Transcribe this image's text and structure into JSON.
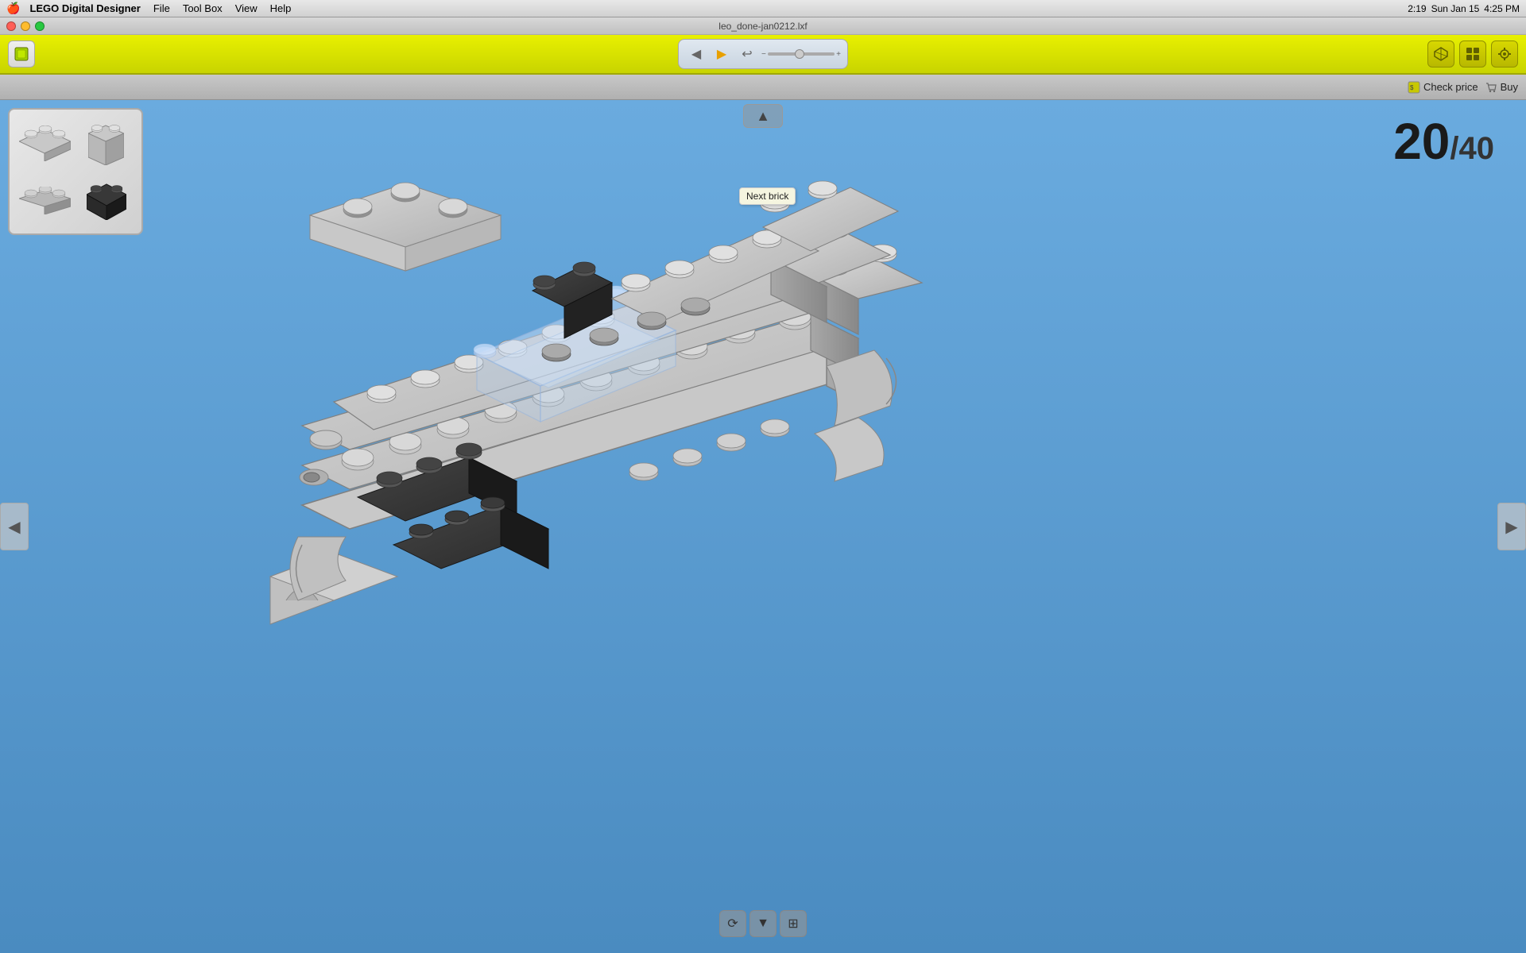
{
  "menubar": {
    "apple": "🍎",
    "app_name": "LEGO Digital Designer",
    "menus": [
      "File",
      "Tool Box",
      "View",
      "Help"
    ],
    "time": "4:25 PM",
    "date": "Sun Jan 15",
    "battery": "2:19"
  },
  "titlebar": {
    "filename": "leo_done-jan0212.lxf"
  },
  "toolbar": {
    "nav": {
      "prev_label": "◀",
      "next_label": "▶",
      "refresh_label": "↩"
    }
  },
  "subtoolbar": {
    "check_price_label": "Check price",
    "buy_label": "Buy"
  },
  "main": {
    "step_current": "20",
    "step_total": "/40",
    "tooltip": "Next brick"
  },
  "brick_preview": {
    "items": [
      {
        "label": "brick-light-1x3",
        "color": "#c8c8c8"
      },
      {
        "label": "brick-light-1x3-side",
        "color": "#c8c8c8"
      },
      {
        "label": "brick-light-1x3-flat",
        "color": "#c0c0c0"
      },
      {
        "label": "brick-dark-1x2",
        "color": "#2a2a2a"
      }
    ]
  },
  "bottom_controls": [
    {
      "name": "rotate-icon",
      "symbol": "⟳"
    },
    {
      "name": "down-icon",
      "symbol": "▼"
    },
    {
      "name": "grid-icon",
      "symbol": "⊞"
    }
  ],
  "nav_arrows": {
    "left": "◀",
    "right": "▶",
    "up": "▲"
  }
}
